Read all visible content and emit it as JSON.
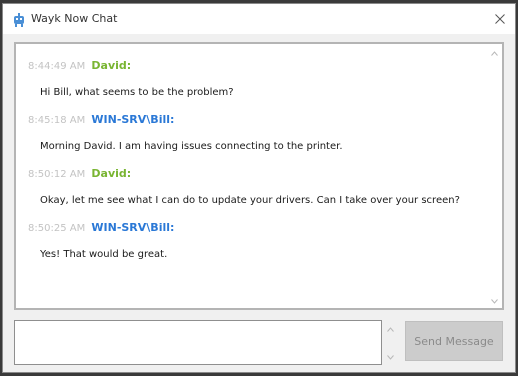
{
  "window": {
    "title": "Wayk Now Chat"
  },
  "colors": {
    "david": "#79b532",
    "bill": "#2a78d6",
    "timestamp": "#c3c3c3"
  },
  "messages": [
    {
      "time": "8:44:49 AM",
      "sender": "David:",
      "sender_color": "#79b532",
      "text": "Hi Bill, what seems to be the problem?"
    },
    {
      "time": "8:45:18 AM",
      "sender": "WIN-SRV\\Bill:",
      "sender_color": "#2a78d6",
      "text": "Morning David.  I am having issues connecting to the printer."
    },
    {
      "time": "8:50:12 AM",
      "sender": "David:",
      "sender_color": "#79b532",
      "text": "Okay, let me see what I can do to update your drivers.  Can I take over your screen?"
    },
    {
      "time": "8:50:25 AM",
      "sender": "WIN-SRV\\Bill:",
      "sender_color": "#2a78d6",
      "text": "Yes!  That would be great."
    }
  ],
  "composer": {
    "value": "",
    "send_label": "Send Message"
  }
}
